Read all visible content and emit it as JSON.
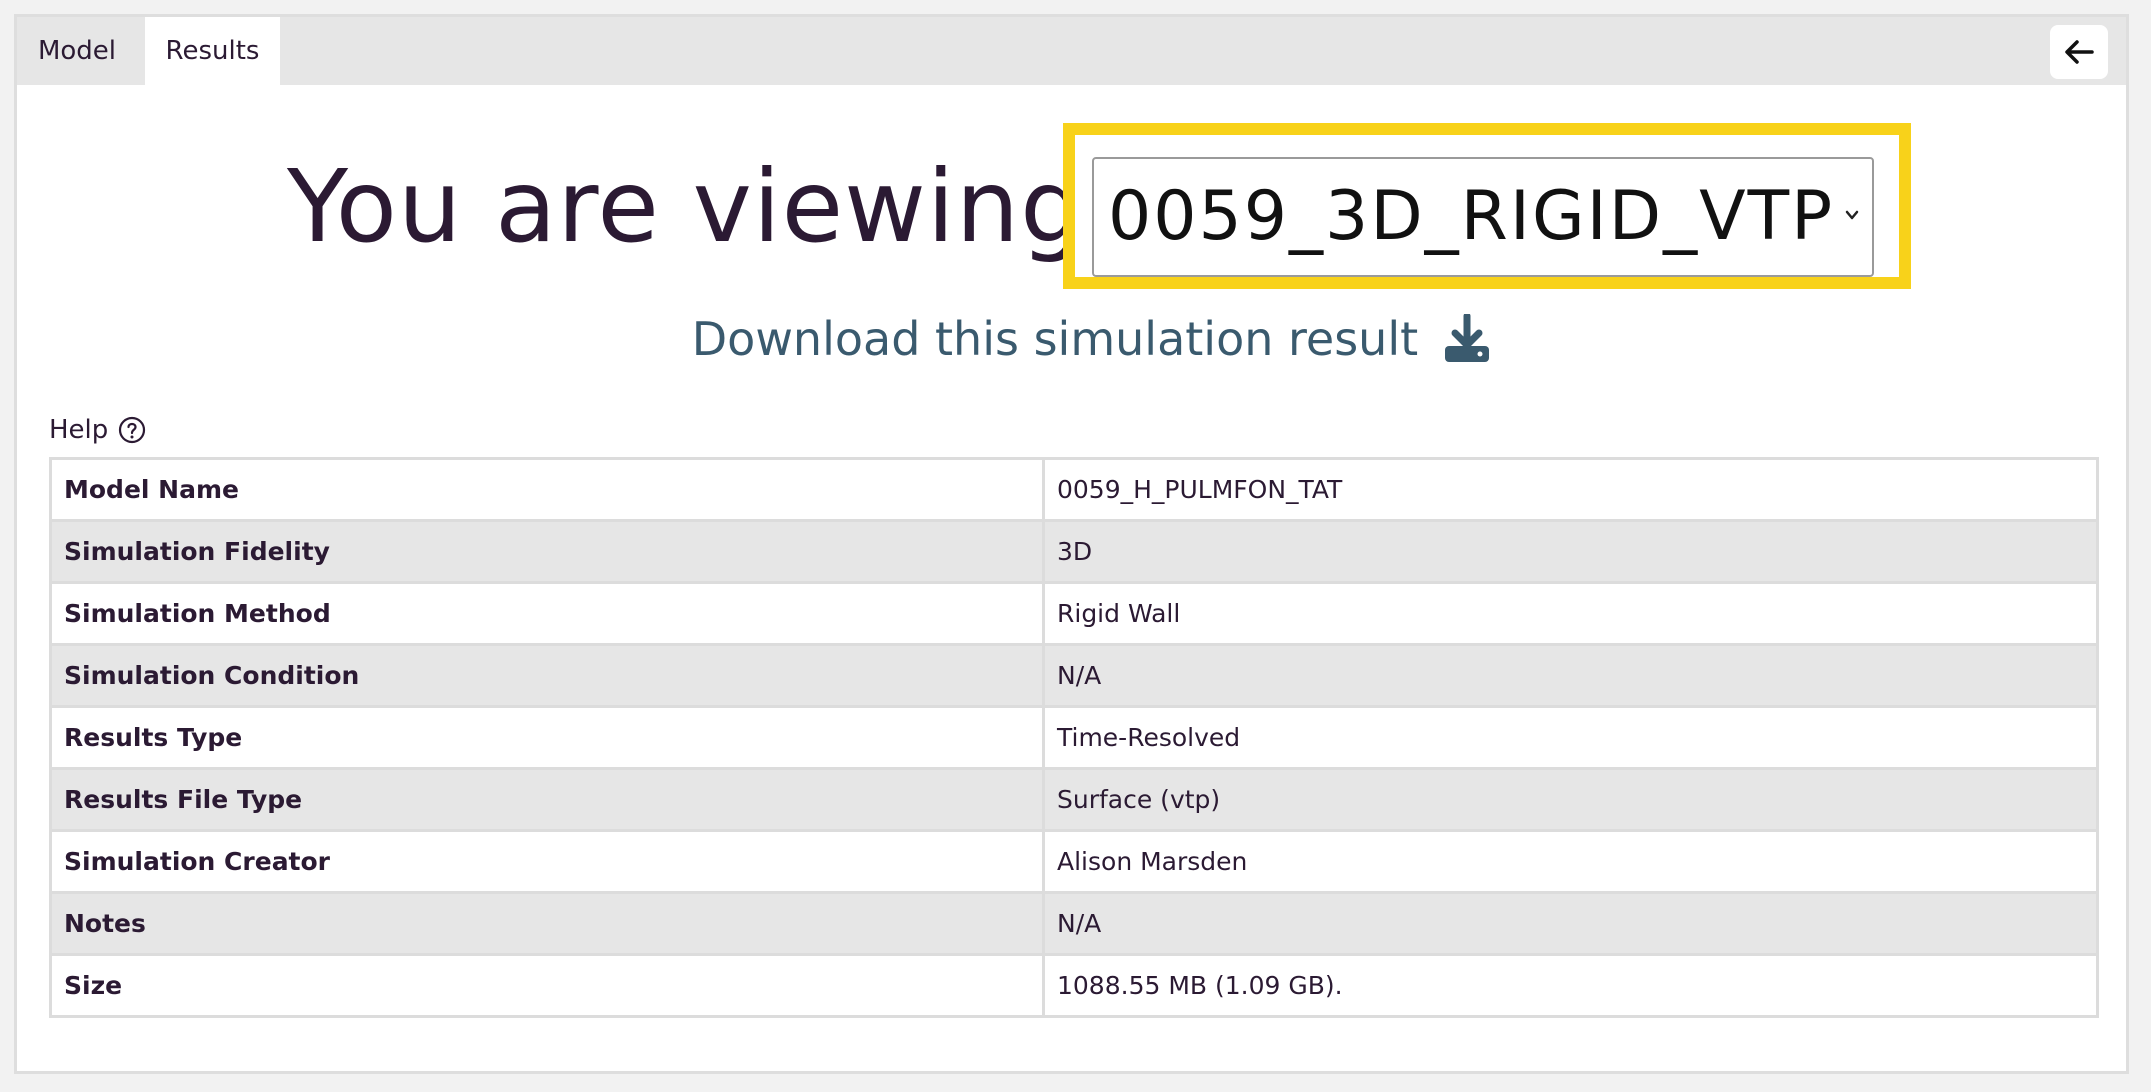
{
  "tabs": [
    {
      "label": "Model"
    },
    {
      "label": "Results"
    }
  ],
  "header": {
    "viewing_label": "You are viewing",
    "selected_result": "0059_3D_RIGID_VTP",
    "highlight_color": "#f8d21a"
  },
  "download": {
    "label": "Download this simulation result",
    "icon": "download-icon"
  },
  "help": {
    "label": "Help",
    "icon": "question-circle-icon"
  },
  "back_icon": "arrow-left-icon",
  "details": [
    {
      "key": "Model Name",
      "value": "0059_H_PULMFON_TAT"
    },
    {
      "key": "Simulation Fidelity",
      "value": "3D"
    },
    {
      "key": "Simulation Method",
      "value": "Rigid Wall"
    },
    {
      "key": "Simulation Condition",
      "value": "N/A"
    },
    {
      "key": "Results Type",
      "value": "Time-Resolved"
    },
    {
      "key": "Results File Type",
      "value": "Surface (vtp)"
    },
    {
      "key": "Simulation Creator",
      "value": "Alison Marsden"
    },
    {
      "key": "Notes",
      "value": "N/A"
    },
    {
      "key": "Size",
      "value": "1088.55 MB (1.09 GB)."
    }
  ]
}
